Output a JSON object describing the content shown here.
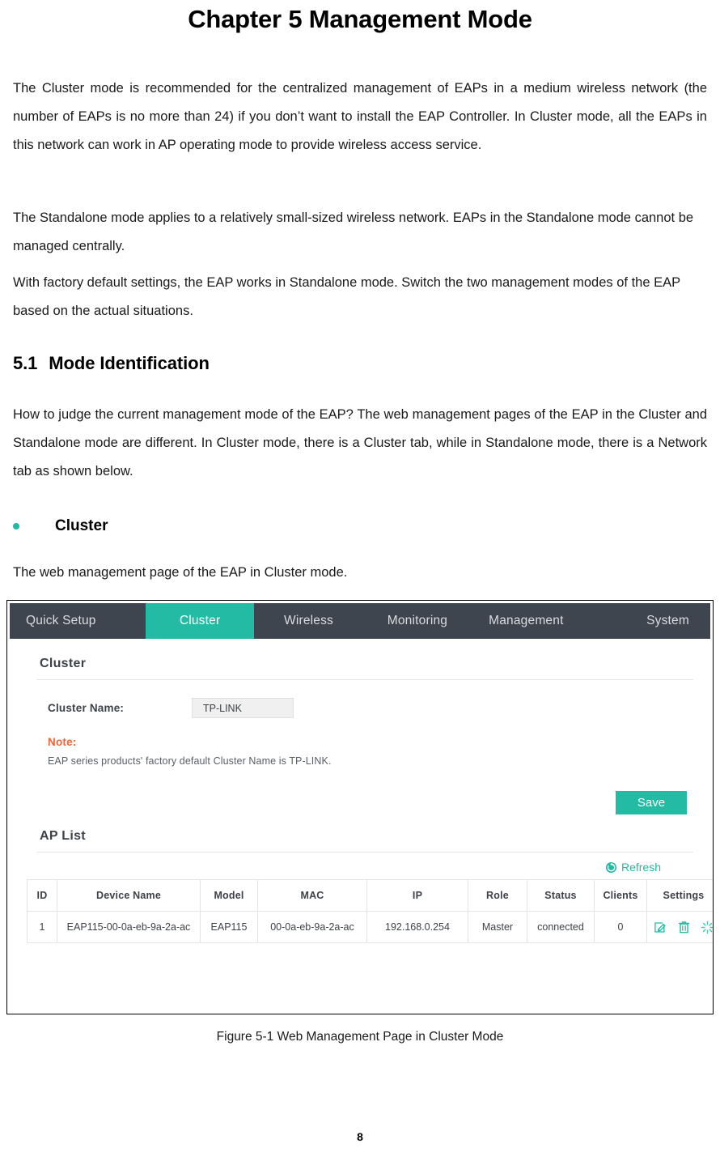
{
  "document": {
    "chapter_title": "Chapter 5  Management Mode",
    "paragraphs": [
      "The Cluster mode is recommended for the centralized management of EAPs in a medium wireless network (the number of EAPs is no more than 24) if you don’t want to install the EAP Controller. In Cluster mode, all the EAPs in this network can work in AP operating mode to provide wireless access service.",
      "The Standalone mode applies to a relatively small-sized wireless network. EAPs in the Standalone mode cannot be managed centrally.",
      "With factory default settings, the EAP works in Standalone mode. Switch the two management modes of the EAP based on the actual situations."
    ],
    "section": {
      "number": "5.1",
      "title": "Mode Identification",
      "paragraph": "How to judge the current management mode of the EAP? The web management pages of the EAP in the Cluster and Standalone mode are different. In Cluster mode, there is a Cluster tab, while in Standalone mode, there is a Network tab as shown below."
    },
    "bullet": {
      "label": "Cluster",
      "caption": "The web management page of the EAP in Cluster mode."
    },
    "figure_caption": "Figure 5-1 Web Management Page in Cluster Mode",
    "page_number": "8"
  },
  "screenshot": {
    "nav": {
      "items": [
        {
          "label": "Quick Setup",
          "active": false
        },
        {
          "label": "Cluster",
          "active": true
        },
        {
          "label": "Wireless",
          "active": false
        },
        {
          "label": "Monitoring",
          "active": false
        },
        {
          "label": "Management",
          "active": false
        },
        {
          "label": "System",
          "active": false
        }
      ]
    },
    "cluster_panel": {
      "title": "Cluster",
      "cluster_name_label": "Cluster Name:",
      "cluster_name_value": "TP-LINK",
      "cluster_name_placeholder": "TP-LINK",
      "note_title": "Note:",
      "note_text": "EAP series products' factory default Cluster Name is TP-LINK.",
      "save_label": "Save"
    },
    "ap_list": {
      "title": "AP List",
      "refresh_label": "Refresh",
      "columns": [
        "ID",
        "Device Name",
        "Model",
        "MAC",
        "IP",
        "Role",
        "Status",
        "Clients",
        "Settings"
      ],
      "rows": [
        {
          "id": "1",
          "device_name": "EAP115-00-0a-eb-9a-2a-ac",
          "model": "EAP115",
          "mac": "00-0a-eb-9a-2a-ac",
          "ip": "192.168.0.254",
          "role": "Master",
          "status": "connected",
          "clients": "0"
        }
      ]
    },
    "colors": {
      "accent_teal": "#23bba4",
      "nav_dark": "#3f454e",
      "note_orange": "#f4623a"
    }
  }
}
